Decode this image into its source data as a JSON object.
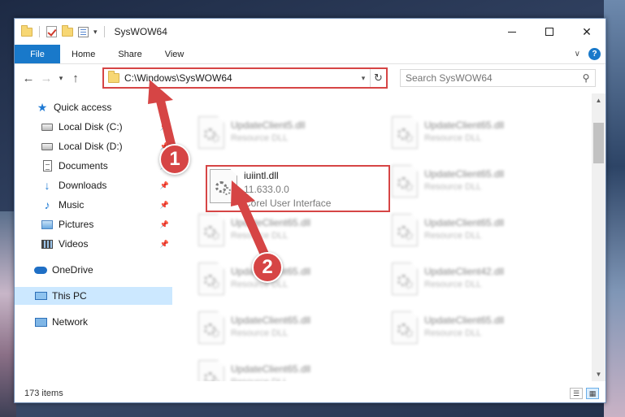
{
  "window": {
    "title": "SysWOW64"
  },
  "ribbon": {
    "tabs": [
      {
        "label": "File"
      },
      {
        "label": "Home"
      },
      {
        "label": "Share"
      },
      {
        "label": "View"
      }
    ]
  },
  "address": {
    "path": "C:\\Windows\\SysWOW64",
    "search_placeholder": "Search SysWOW64"
  },
  "nav": {
    "items": [
      {
        "label": "Quick access",
        "icon": "star-icon"
      },
      {
        "label": "Local Disk (C:)",
        "icon": "disk-icon"
      },
      {
        "label": "Local Disk (D:)",
        "icon": "disk-icon"
      },
      {
        "label": "Documents",
        "icon": "documents-icon"
      },
      {
        "label": "Downloads",
        "icon": "download-icon"
      },
      {
        "label": "Music",
        "icon": "music-icon"
      },
      {
        "label": "Pictures",
        "icon": "pictures-icon"
      },
      {
        "label": "Videos",
        "icon": "videos-icon"
      },
      {
        "label": "OneDrive",
        "icon": "cloud-icon"
      },
      {
        "label": "This PC",
        "icon": "computer-icon"
      },
      {
        "label": "Network",
        "icon": "network-icon"
      }
    ]
  },
  "files": {
    "left": [
      {
        "name": "UpdateClient5.dll",
        "type": "Resource DLL"
      },
      {
        "name": "UpdateClient65.dll",
        "type": "Resource DLL"
      },
      {
        "name": "UpdateClient65.dll",
        "type": "Resource DLL"
      },
      {
        "name": "UpdateClient65.dll",
        "type": "Resource DLL"
      },
      {
        "name": "UpdateClient65.dll",
        "type": "Resource DLL"
      }
    ],
    "right": [
      {
        "name": "UpdateClient65.dll",
        "type": "Resource DLL"
      },
      {
        "name": "UpdateClient65.dll",
        "type": "Resource DLL"
      },
      {
        "name": "UpdateClient65.dll",
        "type": "Resource DLL"
      },
      {
        "name": "UpdateClient42.dll",
        "type": "Resource DLL"
      },
      {
        "name": "UpdateClient65.dll",
        "type": "Resource DLL"
      }
    ],
    "highlighted": {
      "name": "iuiintl.dll",
      "version": "11.633.0.0",
      "description": "Corel User Interface"
    }
  },
  "status": {
    "item_count": "173 items"
  },
  "annotations": {
    "step1": "1",
    "step2": "2",
    "color": "#d64545"
  }
}
